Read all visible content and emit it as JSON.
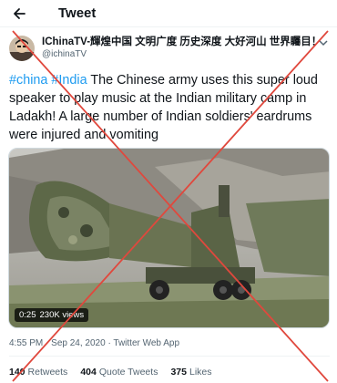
{
  "header": {
    "title": "Tweet",
    "back_icon": "arrow-left-icon"
  },
  "author": {
    "display_name": "IChinaTV-輝煌中国 文明广度 历史深度 大好河山 世界矚目！",
    "handle": "@ichinaTV",
    "more_icon": "chevron-down-icon"
  },
  "tweet": {
    "hashtag1": "#china",
    "hashtag2": "#India",
    "text": " The Chinese army uses this super loud speaker to play music at the Indian military camp in Ladakh! A large number of Indian soldiers' eardrums were injured and vomiting"
  },
  "media": {
    "duration": "0:25",
    "views": "230K views"
  },
  "meta": {
    "time": "4:55 PM",
    "date": "Sep 24, 2020",
    "source": "Twitter Web App",
    "separator": "·"
  },
  "stats": {
    "retweets": {
      "count": "140",
      "label": "Retweets"
    },
    "quotes": {
      "count": "404",
      "label": "Quote Tweets"
    },
    "likes": {
      "count": "375",
      "label": "Likes"
    }
  },
  "colors": {
    "accent": "#1d9bf0",
    "overlay_cross": "#e0483d",
    "muted": "#536471"
  }
}
